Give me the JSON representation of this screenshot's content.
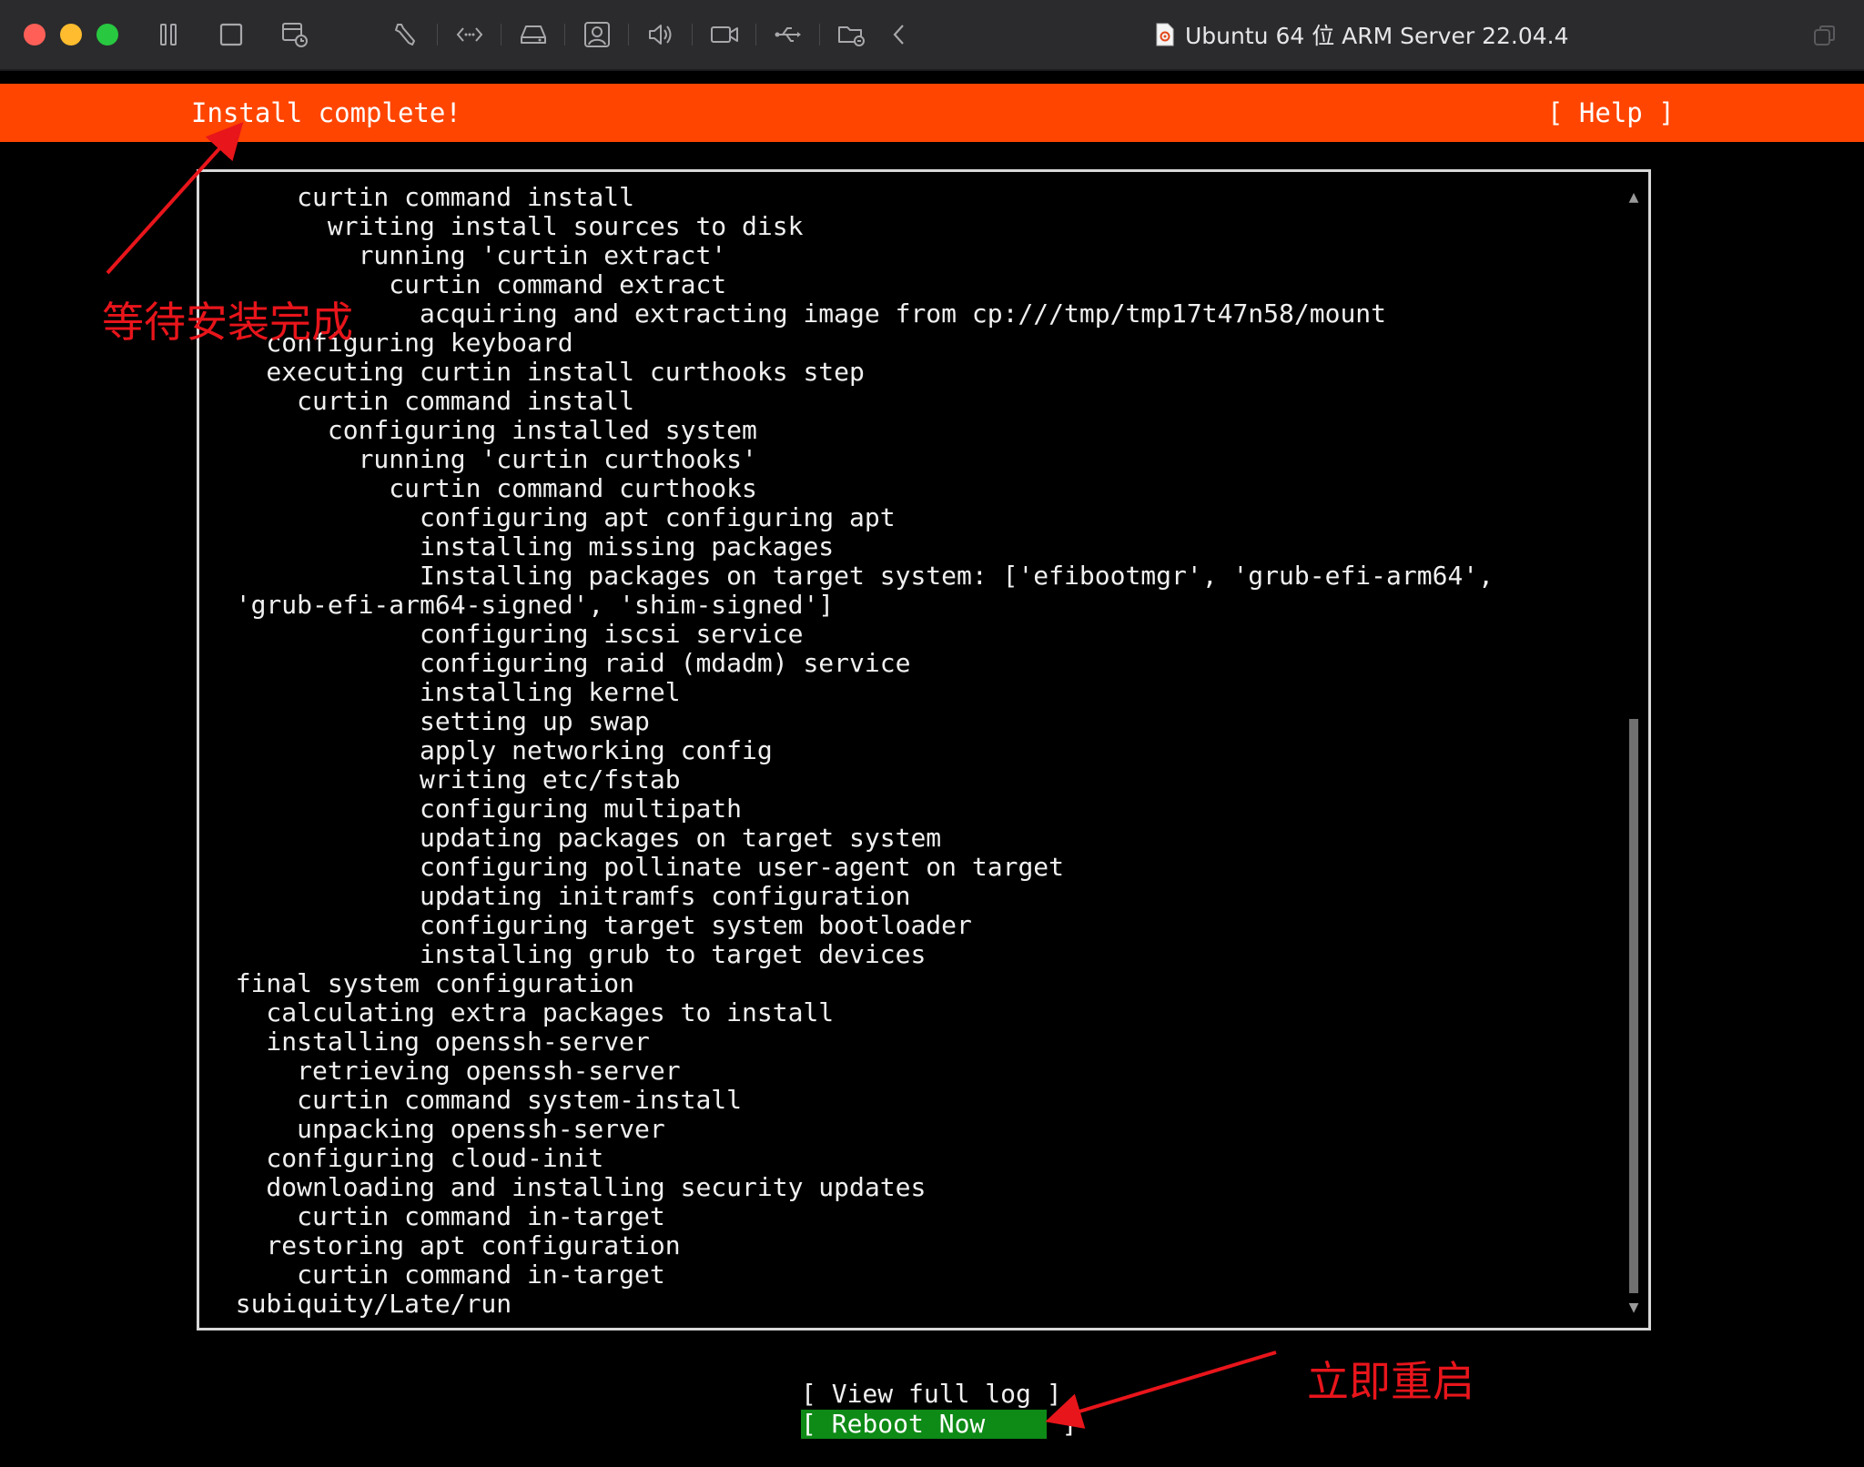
{
  "window": {
    "title": "Ubuntu 64 位 ARM Server 22.04.4",
    "toolbar_icons": [
      "pause-icon",
      "stop-icon",
      "snapshot-icon",
      "settings-wrench-icon",
      "code-icon",
      "disk-icon",
      "user-icon",
      "sound-icon",
      "camera-icon",
      "usb-icon",
      "shared-folder-icon",
      "chevron-left-icon"
    ]
  },
  "installer": {
    "title": "Install complete!",
    "help_label": "[ Help ]",
    "log_lines": [
      "      curtin command install",
      "        writing install sources to disk",
      "          running 'curtin extract'",
      "            curtin command extract",
      "              acquiring and extracting image from cp:///tmp/tmp17t47n58/mount",
      "    configuring keyboard",
      "    executing curtin install curthooks step",
      "      curtin command install",
      "        configuring installed system",
      "          running 'curtin curthooks'",
      "            curtin command curthooks",
      "              configuring apt configuring apt",
      "              installing missing packages",
      "              Installing packages on target system: ['efibootmgr', 'grub-efi-arm64',",
      "  'grub-efi-arm64-signed', 'shim-signed']",
      "              configuring iscsi service",
      "              configuring raid (mdadm) service",
      "              installing kernel",
      "              setting up swap",
      "              apply networking config",
      "              writing etc/fstab",
      "              configuring multipath",
      "              updating packages on target system",
      "              configuring pollinate user-agent on target",
      "              updating initramfs configuration",
      "              configuring target system bootloader",
      "              installing grub to target devices",
      "  final system configuration",
      "    calculating extra packages to install",
      "    installing openssh-server",
      "      retrieving openssh-server",
      "      curtin command system-install",
      "      unpacking openssh-server",
      "    configuring cloud-init",
      "    downloading and installing security updates",
      "      curtin command in-target",
      "    restoring apt configuration",
      "      curtin command in-target",
      "  subiquity/Late/run"
    ],
    "scroll": {
      "position": 0.47,
      "visible_fraction": 0.53
    },
    "view_log_label": "[ View full log ]",
    "reboot_label": "[ Reboot Now     ]"
  },
  "annotations": {
    "wait_label": "等待安装完成",
    "reboot_label": "立即重启",
    "color": "#e8151b"
  },
  "colors": {
    "header": "#ff4500",
    "reboot_button": "#0e8a16"
  }
}
